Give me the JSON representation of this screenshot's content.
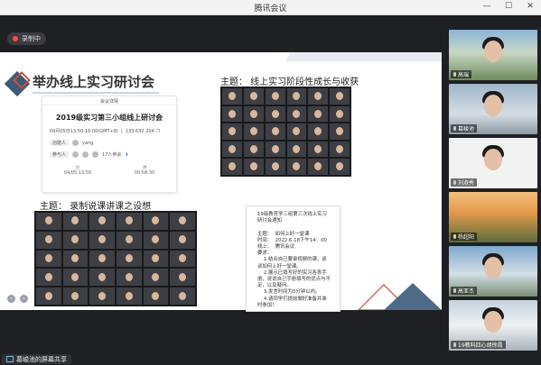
{
  "window": {
    "title": "腾讯会议"
  },
  "recording": {
    "label": "录制中"
  },
  "slide": {
    "title": "举办线上实习研讨会",
    "meeting_card": {
      "header": "会议详情",
      "meeting_title": "2019级实习第三小组线上研讨会",
      "time": "04月05日13:50-16:00(GMT+8)",
      "meeting_id": "133 632 204",
      "host_label": "创建人",
      "host_name": "yang",
      "attendee_label": "参与人",
      "attendee_count": "17人参会",
      "start_time": "04/05 13:56",
      "duration": "00:58:30"
    },
    "heading_top": "主题：  线上实习阶段性成长与收获",
    "heading_bottom": "主题：  录制说课讲课之设想",
    "notice_lines": [
      "19级教育学三组第三次线上实习",
      "研讨会通知",
      "",
      "主题：  如何上好一堂课",
      "时间：  2022.6.18下午14：00",
      "线上：  腾讯会议",
      "要求：",
      "    1.结合自己要录视频的课，谈",
      "谈如何上好一堂课。",
      "    2.展示已填写好的实习各表手",
      "册，说说自己手册填写的优点与不",
      "足，以及疑问。",
      "    3.发言时间为5分钟以内。",
      "    4.请同学们提前做好准备并准",
      "时参加！"
    ]
  },
  "share": {
    "label": "葛峻池的屏幕共享"
  },
  "participants": [
    {
      "name": "高瑞"
    },
    {
      "name": "葛峻池"
    },
    {
      "name": "刘淑秀"
    },
    {
      "name": "杨超阳"
    },
    {
      "name": "高亚杰"
    },
    {
      "name": "19教科四心胡徐霞"
    }
  ],
  "icons": {
    "minimize": "minimize-icon",
    "restore": "restore-icon",
    "close": "close-icon",
    "record": "record-icon",
    "share": "screen-share-icon"
  }
}
